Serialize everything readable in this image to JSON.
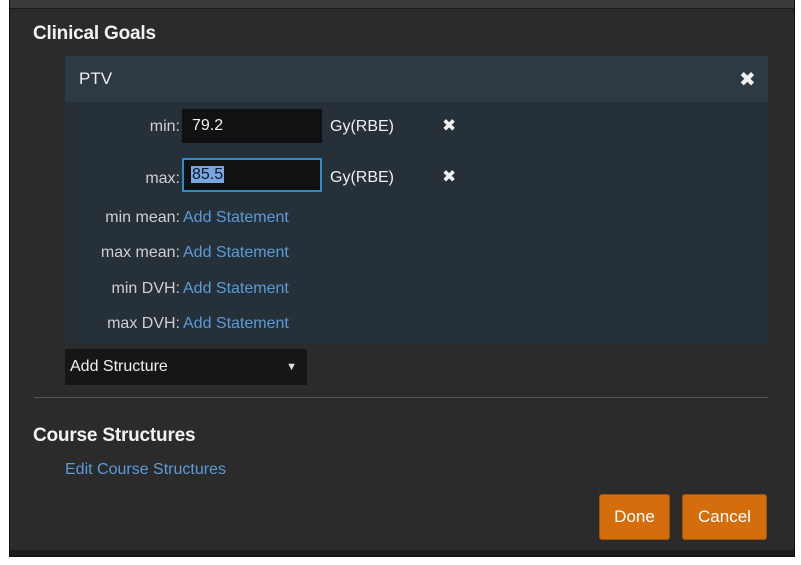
{
  "clinical_goals": {
    "title": "Clinical Goals",
    "structure": {
      "name": "PTV",
      "remove_icon": "close-icon",
      "min": {
        "label": "min:",
        "value": "79.2",
        "unit": "Gy(RBE)"
      },
      "max": {
        "label": "max:",
        "value": "85.5",
        "unit": "Gy(RBE)"
      },
      "min_mean": {
        "label": "min mean:",
        "action": "Add Statement"
      },
      "max_mean": {
        "label": "max mean:",
        "action": "Add Statement"
      },
      "min_dvh": {
        "label": "min DVH:",
        "action": "Add Statement"
      },
      "max_dvh": {
        "label": "max DVH:",
        "action": "Add Statement"
      }
    },
    "add_structure": {
      "label": "Add Structure",
      "icon": "caret-down-icon"
    }
  },
  "course_structures": {
    "title": "Course Structures",
    "edit_link": "Edit Course Structures"
  },
  "footer": {
    "done": "Done",
    "cancel": "Cancel"
  },
  "colors": {
    "dialog_bg": "#2b2b2b",
    "panel_bg": "#253038",
    "panel_header_bg": "#2d3a44",
    "link": "#5b9bd8",
    "accent_button": "#d46e0c",
    "focus_border": "#2f8ac8"
  }
}
